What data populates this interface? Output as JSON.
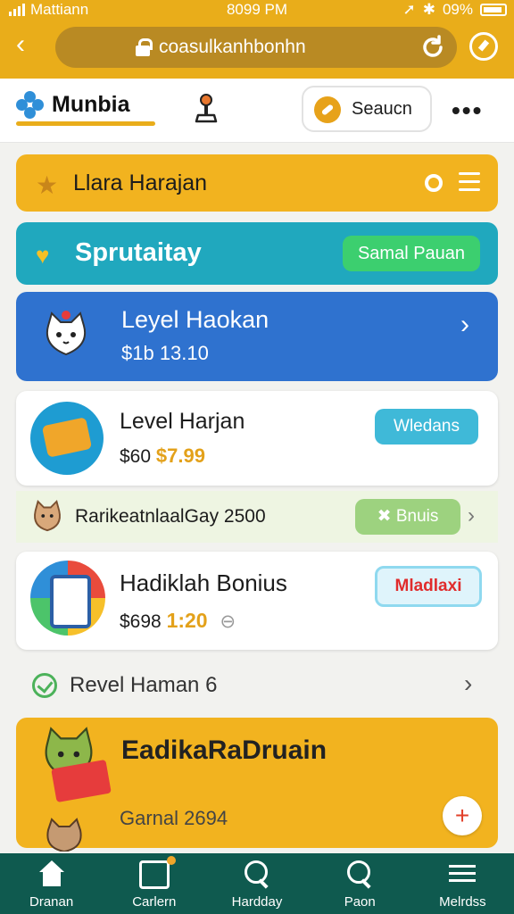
{
  "status": {
    "carrier": "Mattiann",
    "time": "8099 PM",
    "battery": "09%"
  },
  "browser": {
    "url": "coasulkanhbonhn"
  },
  "header": {
    "brand": "Munbia",
    "search_label": "Seaucn"
  },
  "cards": {
    "c1": {
      "title": "Llara Harajan"
    },
    "c2": {
      "title": "Sprutaitay",
      "button": "Samal Pauan"
    },
    "c3": {
      "title": "Leyel Haokan",
      "subtitle": "$1b 13.10"
    },
    "c4": {
      "title": "Level Harjan",
      "price_prefix": "$60",
      "price": "$7.99",
      "button": "Wledans"
    },
    "c5": {
      "title": "RarikeatnlaalGay 2500",
      "button": "Bnuis"
    },
    "c6": {
      "title": "Hadiklah Bonius",
      "price_prefix": "$698",
      "price": "1:20",
      "button": "Mladlaxi"
    },
    "row7": {
      "title": "Revel Haman 6"
    },
    "c8": {
      "title": "EadikaRaDruain",
      "subtitle": "Garnal 2694"
    }
  },
  "nav": [
    {
      "label": "Dranan",
      "icon": "home-icon"
    },
    {
      "label": "Carlern",
      "icon": "cart-icon"
    },
    {
      "label": "Hardday",
      "icon": "search-icon"
    },
    {
      "label": "Paon",
      "icon": "search-icon"
    },
    {
      "label": "Melrdss",
      "icon": "menu-icon"
    }
  ],
  "colors": {
    "accent": "#e9ad1a",
    "teal": "#20a8be",
    "blue": "#2f72cf",
    "nav": "#0f5a4f",
    "green": "#3ccf6f"
  }
}
